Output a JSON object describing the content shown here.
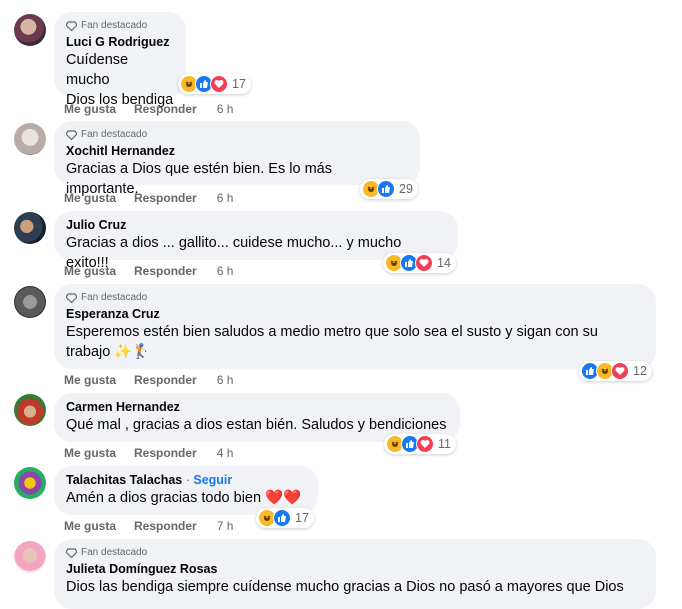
{
  "labels": {
    "fan": "Fan destacado",
    "like": "Me gusta",
    "reply": "Responder",
    "follow": "Seguir"
  },
  "colors": {
    "link": "#1877f2",
    "bubble": "#f0f2f5",
    "meta": "#65676b"
  },
  "comments": [
    {
      "name": "Luci G Rodriguez",
      "fan": true,
      "lines": [
        "Cuídense mucho",
        "Dios los bendiga"
      ],
      "time": "6 h",
      "reactions": [
        "haha",
        "like",
        "love"
      ],
      "count": "17"
    },
    {
      "name": "Xochitl Hernandez",
      "fan": true,
      "lines": [
        "Gracias a Dios que estén bien. Es lo más importante."
      ],
      "time": "6 h",
      "reactions": [
        "haha",
        "like"
      ],
      "count": "29"
    },
    {
      "name": "Julio Cruz",
      "fan": false,
      "lines": [
        "Gracias a dios ... gallito... cuidese mucho... y mucho exito!!!"
      ],
      "time": "6 h",
      "reactions": [
        "haha",
        "like",
        "love"
      ],
      "count": "14"
    },
    {
      "name": "Esperanza Cruz",
      "fan": true,
      "lines": [
        "Esperemos estén bien saludos a medio metro que solo sea el susto y sigan con su",
        "trabajo ✨🏌️"
      ],
      "time": "6 h",
      "reactions": [
        "like",
        "haha",
        "love"
      ],
      "count": "12"
    },
    {
      "name": "Carmen Hernandez",
      "fan": false,
      "lines": [
        "Qué mal , gracias a dios estan bién. Saludos y bendiciones"
      ],
      "time": "4 h",
      "reactions": [
        "haha",
        "like",
        "love"
      ],
      "count": "11"
    },
    {
      "name": "Talachitas Talachas",
      "fan": false,
      "follow": true,
      "lines": [
        "Amén a dios gracias todo bien ❤️❤️"
      ],
      "time": "7 h",
      "reactions": [
        "haha",
        "like"
      ],
      "count": "17"
    },
    {
      "name": "Julieta Domínguez Rosas",
      "fan": true,
      "lines": [
        "Dios las bendiga siempre cuídense mucho gracias a Dios no pasó a mayores que Dios"
      ],
      "time": "",
      "reactions": [],
      "count": ""
    }
  ]
}
